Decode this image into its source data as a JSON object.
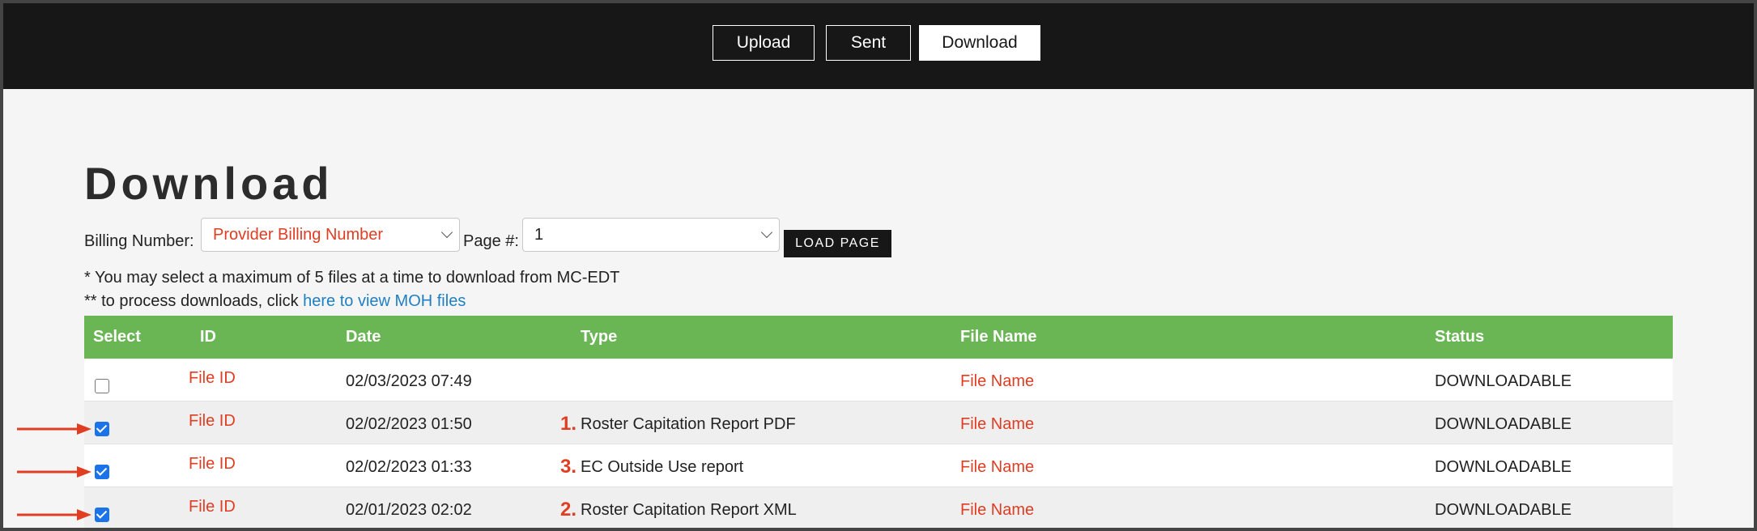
{
  "nav": {
    "upload_label": "Upload",
    "sent_label": "Sent",
    "download_label": "Download",
    "active": "Download"
  },
  "page_title": "Download",
  "filters": {
    "billing_label": "Billing Number:",
    "billing_value": "Provider Billing Number",
    "page_label": "Page #:",
    "page_value": "1",
    "load_button": "LOAD PAGE"
  },
  "notes": {
    "line1": "* You may select a maximum of 5 files at a time to download from MC-EDT",
    "line2_prefix": "** to process downloads, click ",
    "line2_link": "here to view MOH files"
  },
  "table": {
    "headers": [
      "Select",
      "ID",
      "Date",
      "Type",
      "File Name",
      "Status"
    ],
    "rows": [
      {
        "checked": false,
        "id": "File ID",
        "date": "02/03/2023 07:49",
        "marker": "",
        "type": "",
        "file_name": "File Name",
        "status": "DOWNLOADABLE",
        "arrow": false
      },
      {
        "checked": true,
        "id": "File ID",
        "date": "02/02/2023 01:50",
        "marker": "1.",
        "type": "Roster Capitation Report PDF",
        "file_name": "File Name",
        "status": "DOWNLOADABLE",
        "arrow": true
      },
      {
        "checked": true,
        "id": "File ID",
        "date": "02/02/2023 01:33",
        "marker": "3.",
        "type": "EC Outside Use report",
        "file_name": "File Name",
        "status": "DOWNLOADABLE",
        "arrow": true
      },
      {
        "checked": true,
        "id": "File ID",
        "date": "02/01/2023 02:02",
        "marker": "2.",
        "type": "Roster Capitation Report XML",
        "file_name": "File Name",
        "status": "DOWNLOADABLE",
        "arrow": true
      }
    ]
  },
  "colors": {
    "header_green": "#6ab554",
    "accent_red": "#e03d22",
    "link_blue": "#1f7fc4",
    "topbar": "#171717"
  },
  "icons": {
    "annotation_arrow": "arrow-right-icon",
    "select_chevron": "chevron-down-icon",
    "checkbox": "checkbox-icon"
  }
}
